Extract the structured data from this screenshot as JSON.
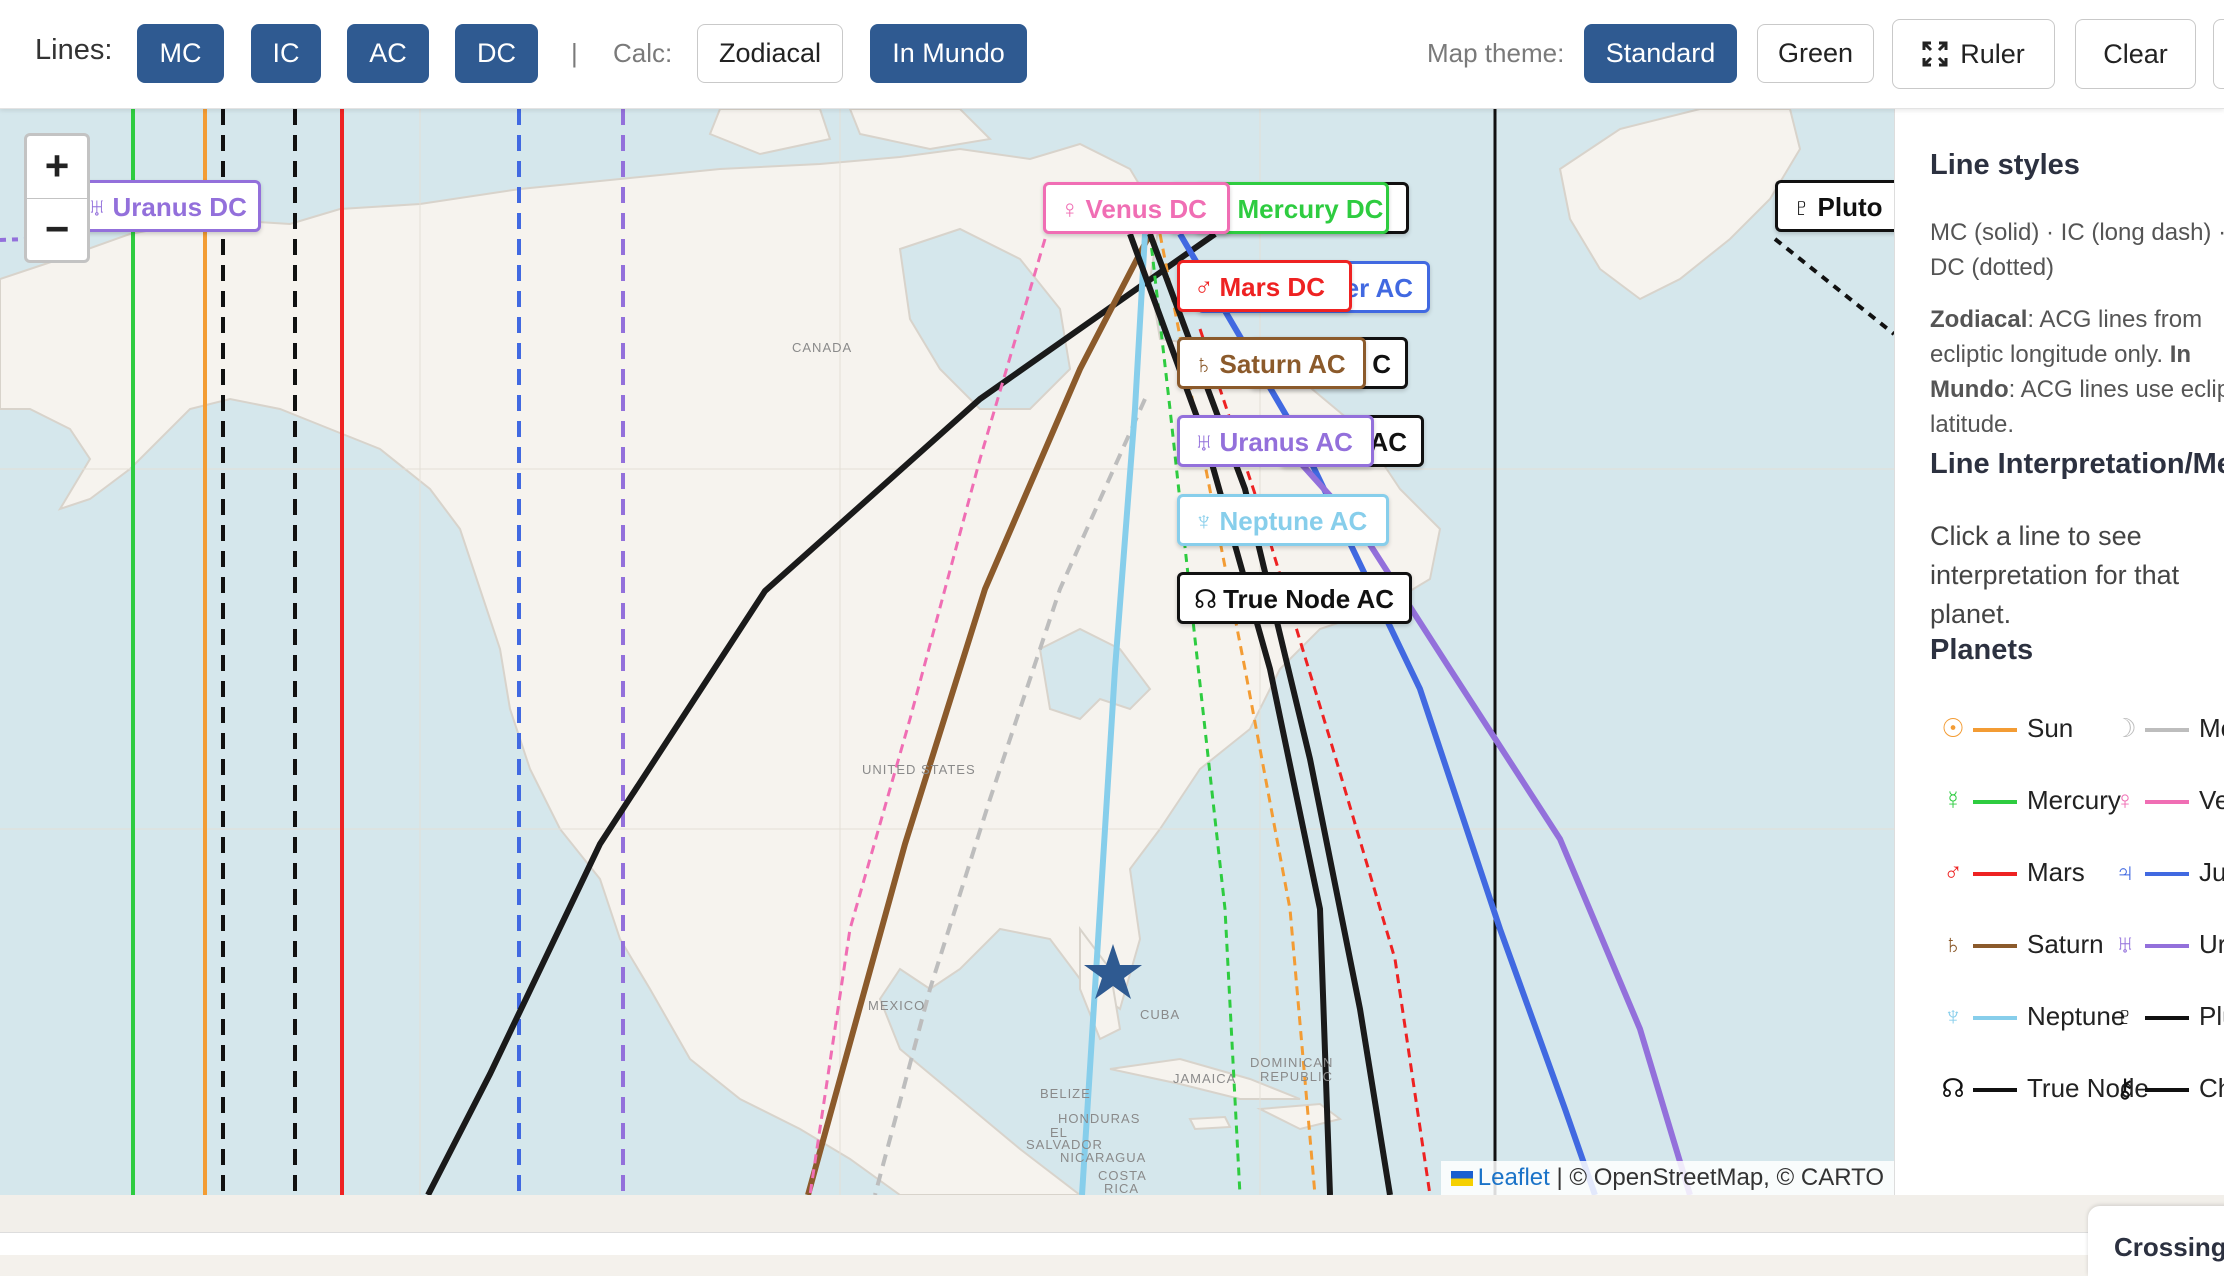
{
  "toolbar": {
    "lines_label": "Lines:",
    "line_buttons": [
      "MC",
      "IC",
      "AC",
      "DC"
    ],
    "separator": "|",
    "calc_label": "Calc:",
    "calc_options": [
      "Zodiacal",
      "In Mundo"
    ],
    "calc_selected": "In Mundo",
    "theme_label": "Map theme:",
    "theme_options": [
      "Standard",
      "Green"
    ],
    "theme_selected": "Standard",
    "ruler_label": "Ruler",
    "clear_label": "Clear"
  },
  "map": {
    "zoom_in": "+",
    "zoom_out": "−",
    "countries": [
      "CANADA",
      "UNITED STATES",
      "MEXICO",
      "CUBA",
      "JAMAICA",
      "DOMINICAN",
      "REPUBLIC",
      "BELIZE",
      "HONDURAS",
      "EL",
      "SALVADOR",
      "NICARAGUA",
      "COSTA",
      "RICA"
    ],
    "labels": [
      {
        "glyph": "♅",
        "text": "Uranus DC",
        "color": "#9370db"
      },
      {
        "glyph": "☿",
        "text": "Mercury DC",
        "color": "#2ecc40"
      },
      {
        "glyph": "♀",
        "text": "Venus DC",
        "color": "#f06eb4"
      },
      {
        "glyph": "♃",
        "text": "Jupiter AC",
        "color": "#4169e1"
      },
      {
        "glyph": "♂",
        "text": "Mars DC",
        "color": "#ee2222"
      },
      {
        "glyph": "",
        "text": "C",
        "color": "#111111"
      },
      {
        "glyph": "♄",
        "text": "Saturn AC",
        "color": "#8b5a2b"
      },
      {
        "glyph": "",
        "text": "AC",
        "color": "#111111"
      },
      {
        "glyph": "♅",
        "text": "Uranus AC",
        "color": "#9370db"
      },
      {
        "glyph": "♆",
        "text": "Neptune AC",
        "color": "#87ceeb"
      },
      {
        "glyph": "☊",
        "text": "True Node AC",
        "color": "#111111"
      },
      {
        "glyph": "♇",
        "text": "Pluto",
        "color": "#111111"
      }
    ],
    "attribution": {
      "leaflet": "Leaflet",
      "rest": " | © OpenStreetMap, © CARTO"
    }
  },
  "sidebar": {
    "styles_heading": "Line styles",
    "styles_text": "MC (solid) · IC (long dash) · DC (dotted)",
    "zodiacal_bold": "Zodiacal",
    "zodiacal_text": ": ACG lines from ecliptic longitude only.",
    "inmundo_bold": "In Mundo",
    "inmundo_text": ": ACG lines use ecliptic latitude.",
    "interp_heading": "Line Interpretation/Meaning",
    "interp_text": "Click a line to see interpretation for that planet.",
    "planets_heading": "Planets",
    "planets": [
      {
        "glyph": "☉",
        "name": "Sun",
        "color": "#f39c34"
      },
      {
        "glyph": "☽",
        "name": "Moon",
        "color": "#bdbdbd"
      },
      {
        "glyph": "☿",
        "name": "Mercury",
        "color": "#2ecc40"
      },
      {
        "glyph": "♀",
        "name": "Venus",
        "color": "#f06eb4"
      },
      {
        "glyph": "♂",
        "name": "Mars",
        "color": "#ee2222"
      },
      {
        "glyph": "♃",
        "name": "Jupiter",
        "color": "#4169e1"
      },
      {
        "glyph": "♄",
        "name": "Saturn",
        "color": "#8b5a2b"
      },
      {
        "glyph": "♅",
        "name": "Uranus",
        "color": "#9370db"
      },
      {
        "glyph": "♆",
        "name": "Neptune",
        "color": "#87ceeb"
      },
      {
        "glyph": "♇",
        "name": "Pluto",
        "color": "#111111"
      },
      {
        "glyph": "☊",
        "name": "True Node",
        "color": "#111111"
      },
      {
        "glyph": "⚷",
        "name": "Chiron",
        "color": "#111111"
      }
    ]
  },
  "crossings_label": "Crossings"
}
